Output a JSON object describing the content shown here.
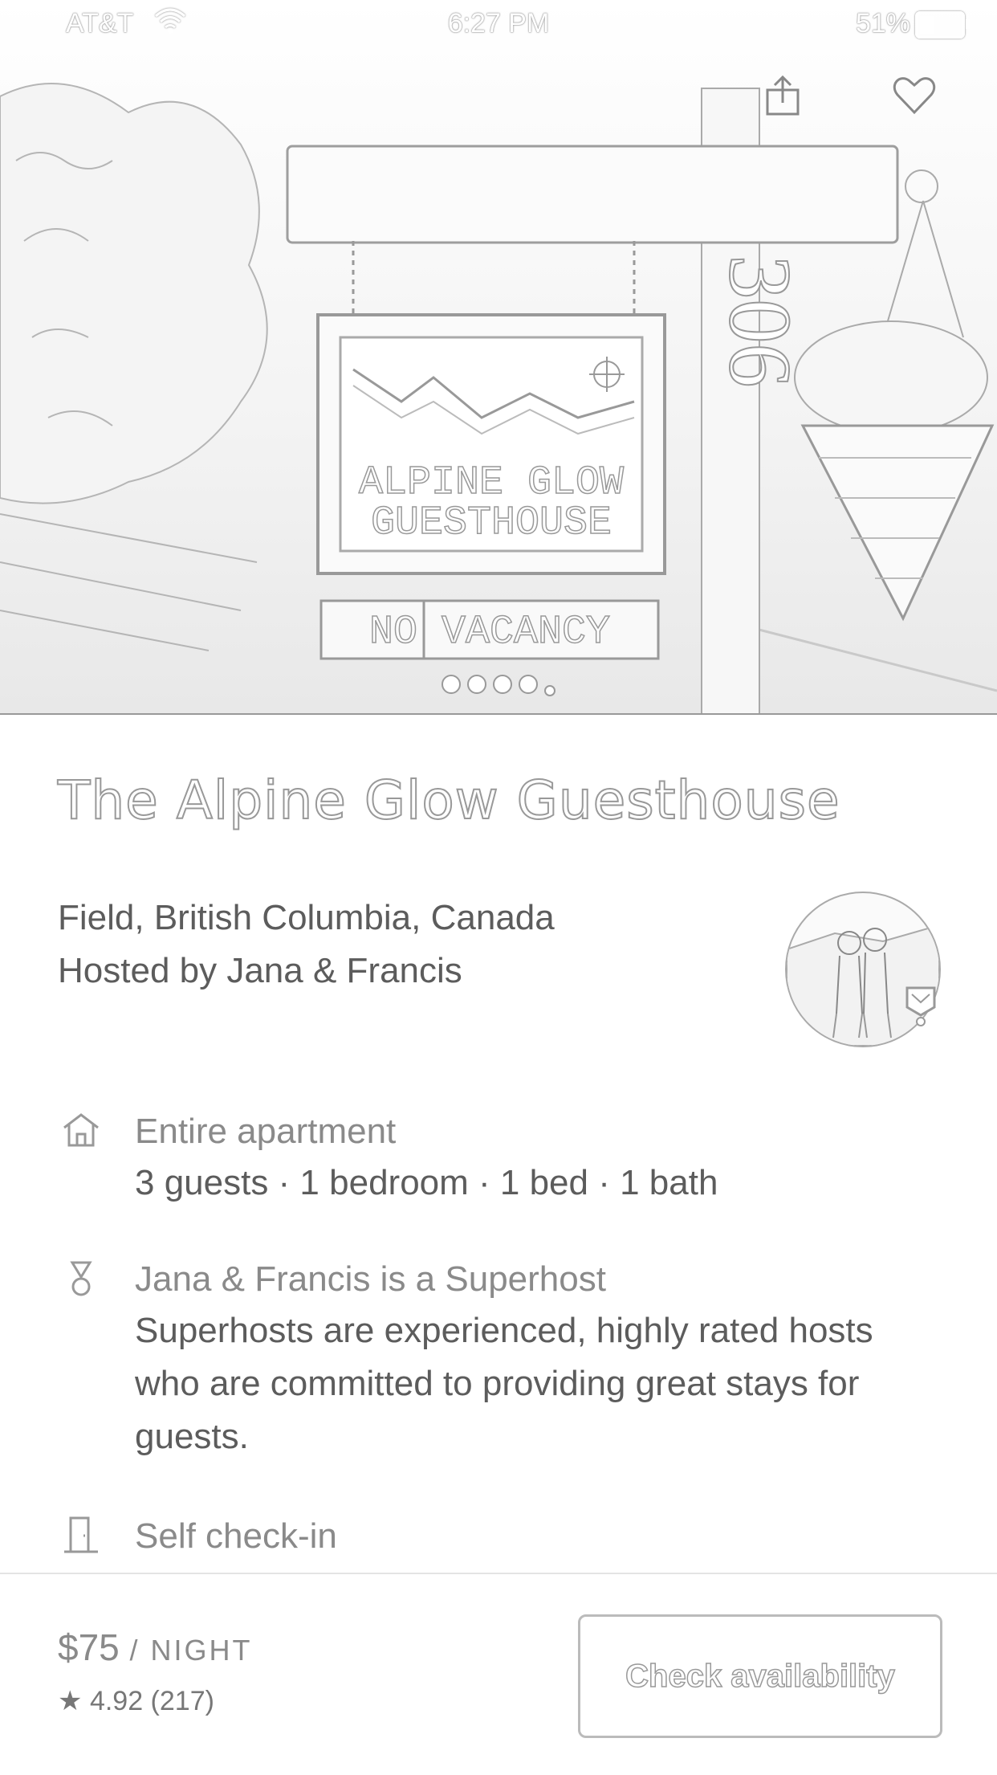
{
  "status_bar": {
    "carrier": "AT&T",
    "time": "6:27 PM",
    "battery": "51%"
  },
  "hero": {
    "photo_label": "photo of the guesthouse sign",
    "sign_text": [
      "ALPINE GLOW",
      "GUESTHOUSE"
    ],
    "vacancy_text": "NO VACANCY",
    "house_number": "306",
    "page_count": 6,
    "current_page": 1
  },
  "listing": {
    "title": "The Alpine Glow Guesthouse",
    "location": "Field, British Columbia, Canada",
    "hosted_by": "Hosted by Jana & Francis"
  },
  "features": [
    {
      "icon": "home-icon",
      "title": "Entire apartment",
      "subtitle": "3 guests · 1 bedroom · 1 bed · 1 bath"
    },
    {
      "icon": "medal-icon",
      "title": "Jana & Francis is a Superhost",
      "subtitle": "Superhosts are experienced, highly rated hosts who are committed to providing great stays for guests."
    },
    {
      "icon": "door-icon",
      "title": "Self check-in",
      "subtitle": ""
    }
  ],
  "booking": {
    "price": "$75",
    "per": "/ NIGHT",
    "rating_star": "★",
    "rating": "4.92 (217)",
    "check_label": "Check availability"
  }
}
